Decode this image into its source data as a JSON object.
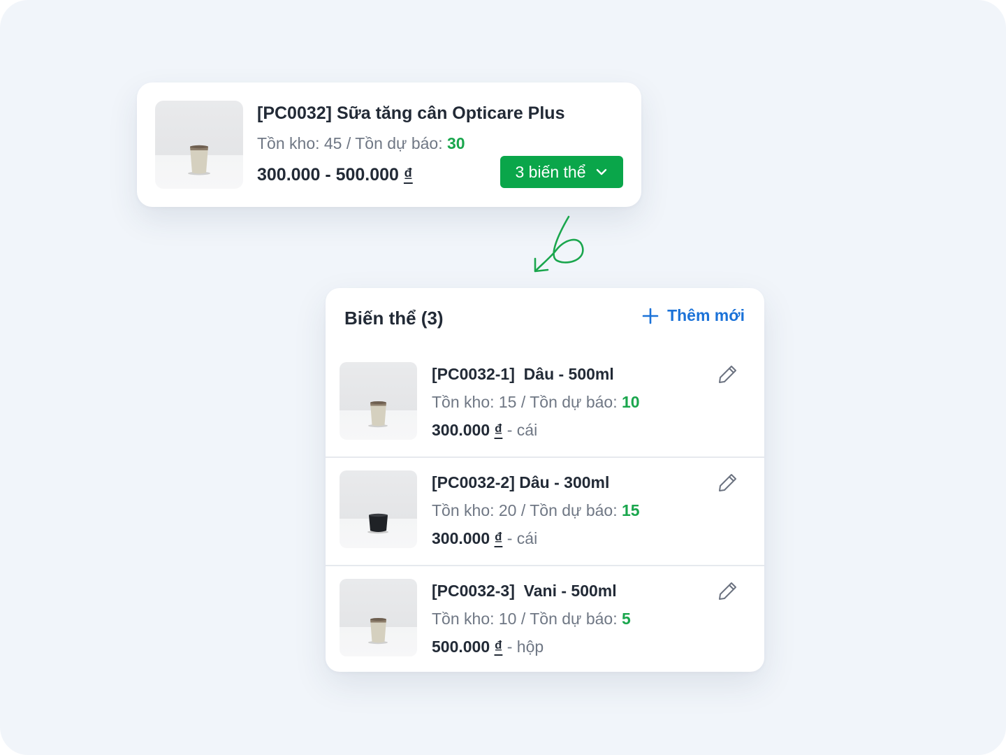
{
  "colors": {
    "background": "#f1f5fa",
    "green": "#0aa64a",
    "blue": "#1b72d8",
    "text": "#222a36",
    "muted": "#6f7784"
  },
  "product": {
    "title": "[PC0032] Sữa tăng cân Opticare Plus",
    "stock_label": "Tồn kho: 45",
    "separator": "/",
    "forecast_label": "Tồn dự báo:",
    "forecast_value": "30",
    "price_range": "300.000 - 500.000",
    "currency": "₫",
    "variants_button": "3 biến thể",
    "thumbnail": {
      "cup_color": "beige",
      "icon": "cup-image"
    }
  },
  "variants_panel": {
    "title": "Biến thể (3)",
    "add_new": "Thêm mới",
    "items": [
      {
        "code": "[PC0032-1]  Dâu - 500ml",
        "stock_label": "Tồn kho: 15",
        "separator": "/",
        "forecast_label": "Tồn dự báo:",
        "forecast_value": "10",
        "price": "300.000",
        "currency": "₫",
        "dash": "-",
        "unit": "cái",
        "cup_color": "beige"
      },
      {
        "code": "[PC0032-2] Dâu - 300ml",
        "stock_label": "Tồn kho: 20",
        "separator": "/",
        "forecast_label": "Tồn dự báo:",
        "forecast_value": "15",
        "price": "300.000",
        "currency": "₫",
        "dash": "-",
        "unit": "cái",
        "cup_color": "black"
      },
      {
        "code": "[PC0032-3]  Vani - 500ml",
        "stock_label": "Tồn kho: 10",
        "separator": "/",
        "forecast_label": "Tồn dự báo:",
        "forecast_value": "5",
        "price": "500.000",
        "currency": "₫",
        "dash": "-",
        "unit": "hộp",
        "cup_color": "beige"
      }
    ]
  }
}
